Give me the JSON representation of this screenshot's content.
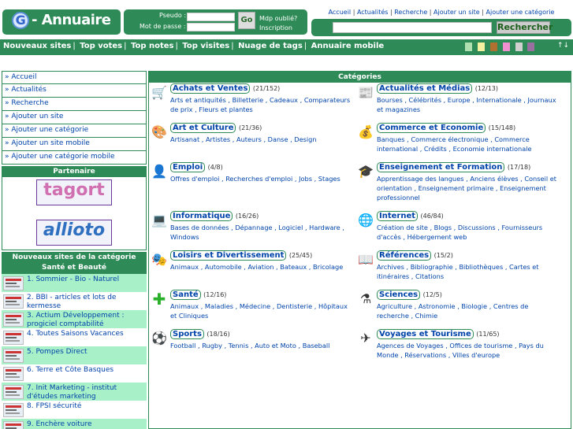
{
  "logo": {
    "text": "- Annuaire",
    "letter": "G"
  },
  "login": {
    "pseudo_label": "Pseudo :",
    "password_label": "Mot de passe :",
    "go_label": "Go",
    "forgot_label": "Mdp oublié?",
    "signup_label": "Inscription"
  },
  "toplinks": [
    "Accueil",
    "Actualités",
    "Recherche",
    "Ajouter un site",
    "Ajouter une catégorie"
  ],
  "search": {
    "button_label": "Rechercher"
  },
  "nav": [
    "Nouveaux sites",
    "Top votes",
    "Top notes",
    "Top visites",
    "Nuage de tags",
    "Annuaire mobile"
  ],
  "nav_arrows": "↑↓",
  "swatch_colors": [
    "#b0e0b0",
    "#f5f0a0",
    "#b07030",
    "#f090d0",
    "#d0d0d0",
    "#9a70a0"
  ],
  "sidebar": {
    "items": [
      "» Accueil",
      "» Actualités",
      "» Recherche",
      "» Ajouter un site",
      "» Ajouter une catégorie",
      "» Ajouter un site mobile",
      "» Ajouter une catégorie mobile"
    ],
    "partner_title": "Partenaire",
    "banner1": "tagort",
    "banner2": "allioto",
    "newsites_title_1": "Nouveaux sites de la catégorie",
    "newsites_title_2": "Santé et Beauté",
    "newsites": [
      "1. Sommier - Bio - Naturel",
      "2. BBI - articles et lots de kermesse",
      "3. Actium Développement : progiciel comptabilité",
      "4. Toutes Saisons Vacances",
      "5. Pompes Direct",
      "6. Terre et Côte Basques",
      "7. Init Marketing - institut d'études marketing",
      "8. FPSI sécurité",
      "9. Enchère voiture"
    ]
  },
  "main": {
    "title": "Catégories",
    "categories": [
      {
        "name": "Achats et Ventes",
        "count": "(21/152)",
        "subs": "Arts et antiquités , Billetterie , Cadeaux , Comparateurs de prix , Fleurs et plantes",
        "icon": "cart-icon"
      },
      {
        "name": "Actualités et Médias",
        "count": "(12/13)",
        "subs": "Bourses , Célébrités , Europe , Internationale , Journaux et magazines",
        "icon": "newspaper-icon"
      },
      {
        "name": "Art et Culture",
        "count": "(21/36)",
        "subs": "Artisanat , Artistes , Auteurs , Danse , Design",
        "icon": "palette-icon"
      },
      {
        "name": "Commerce et Economie",
        "count": "(15/148)",
        "subs": "Banques , Commerce électronique , Commerce international , Crédits , Economie internationale",
        "icon": "coins-icon"
      },
      {
        "name": "Emploi",
        "count": "(4/8)",
        "subs": "Offres d'emploi , Recherches d'emploi , Jobs , Stages",
        "icon": "person-icon"
      },
      {
        "name": "Enseignement et Formation",
        "count": "(17/18)",
        "subs": "Apprentissage des langues , Anciens élèves , Conseil et orientation , Enseignement primaire , Enseignement professionnel",
        "icon": "graduation-cap-icon"
      },
      {
        "name": "Informatique",
        "count": "(16/26)",
        "subs": "Bases de données , Dépannage , Logiciel , Hardware , Windows",
        "icon": "laptop-icon"
      },
      {
        "name": "Internet",
        "count": "(46/84)",
        "subs": "Création de site , Blogs , Discussions , Fournisseurs d'accès , Hébergement web",
        "icon": "globe-icon"
      },
      {
        "name": "Loisirs et Divertissement",
        "count": "(25/45)",
        "subs": "Animaux , Automobile , Aviation , Bateaux , Bricolage",
        "icon": "mask-icon"
      },
      {
        "name": "Références",
        "count": "(15/2)",
        "subs": "Archives , Bibliographie , Bibliothèques , Cartes et itinéraires , Citations",
        "icon": "book-icon"
      },
      {
        "name": "Santé",
        "count": "(12/16)",
        "subs": "Animaux , Maladies , Médecine , Dentisterie , Hôpitaux et Cliniques",
        "icon": "health-cross-icon"
      },
      {
        "name": "Sciences",
        "count": "(12/5)",
        "subs": "Agriculture , Astronomie , Biologie , Centres de recherche , Chimie",
        "icon": "flask-icon"
      },
      {
        "name": "Sports",
        "count": "(18/16)",
        "subs": "Football , Rugby , Tennis , Auto et Moto , Baseball",
        "icon": "ball-icon"
      },
      {
        "name": "Voyages et Tourisme",
        "count": "(11/65)",
        "subs": "Agences de Voyages , Offices de tourisme , Pays du Monde , Réservations , Villes d'europe",
        "icon": "airplane-icon"
      }
    ]
  }
}
